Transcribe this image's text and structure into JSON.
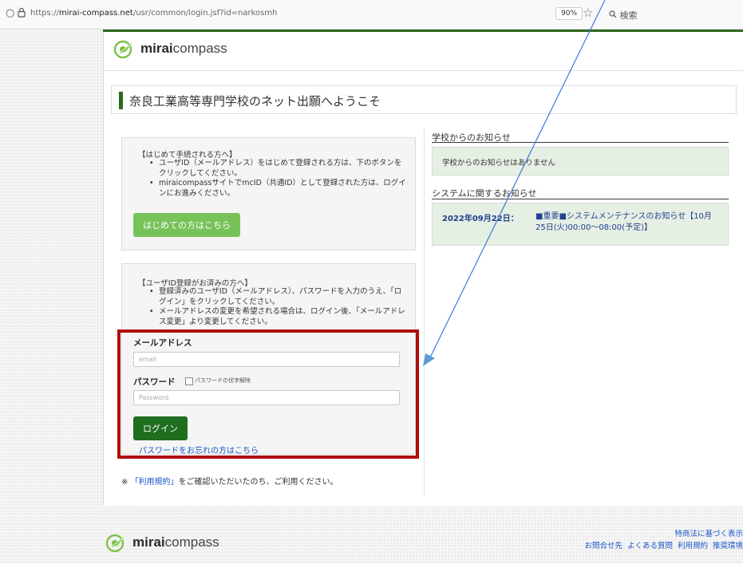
{
  "browser": {
    "url_prefix": "https://",
    "url_domain": "mirai-compass.net",
    "url_path": "/usr/common/login.jsf?id=narkosmh",
    "zoom": "90%",
    "search_placeholder": "検索"
  },
  "brand": {
    "logo_bold": "mirai",
    "logo_light": "compass",
    "accent": "#2d6a1f"
  },
  "page_title": "奈良工業高等専門学校のネット出願へようこそ",
  "first_time": {
    "heading": "【はじめて手続される方へ】",
    "bullets": [
      "ユーザID（メールアドレス）をはじめて登録される方は、下のボタンをクリックしてください。",
      "miraicompassサイトでmcID（共通ID）として登録された方は、ログインにお進みください。"
    ],
    "button": "はじめての方はこちら"
  },
  "registered": {
    "heading": "【ユーザID登録がお済みの方へ】",
    "bullets": [
      "登録済みのユーザID（メールアドレス）、パスワードを入力のうえ、「ログイン」をクリックしてください。",
      "メールアドレスの変更を希望される場合は、ログイン後、「メールアドレス変更」より変更してください。"
    ]
  },
  "login_form": {
    "email_label": "メールアドレス",
    "email_placeholder": "email",
    "password_label": "パスワード",
    "show_password_label": "パスワードの伏字解除",
    "password_placeholder": "Password",
    "login_button": "ログイン",
    "forgot_link": "パスワードをお忘れの方はこちら"
  },
  "note": {
    "prefix": "※ ",
    "link": "「利用規約」",
    "suffix": "をご確認いただいたのち、ご利用ください。"
  },
  "school_news": {
    "heading": "学校からのお知らせ",
    "empty_message": "学校からのお知らせはありません"
  },
  "system_news": {
    "heading": "システムに関するお知らせ",
    "items": [
      {
        "date": "2022年09月22日：",
        "text": "■重要■システムメンテナンスのお知らせ【10月25日(火)00:00～08:00(予定)】"
      }
    ]
  },
  "footer": {
    "top_link": "特商法に基づく表示",
    "links": [
      "お問合せ先",
      "よくある質問",
      "利用規約",
      "推奨環境"
    ]
  }
}
